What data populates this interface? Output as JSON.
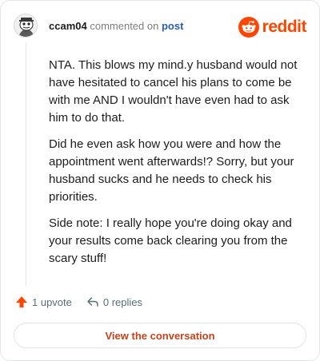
{
  "comment": {
    "username": "ccam04",
    "verb": "commented on",
    "post_link": "post",
    "paragraphs": [
      "NTA. This blows my mind.y husband would not have hesitated to cancel his plans to come be with me AND I wouldn't have even had to ask him to do that.",
      "Did he even ask how you were and how the appointment went afterwards!? Sorry, but your husband sucks and he needs to check his priorities.",
      "Side note: I really hope you're doing okay and your results come back clearing you from the scary stuff!"
    ]
  },
  "brand": {
    "wordmark": "reddit",
    "color": "#ff4500"
  },
  "actions": {
    "upvotes": "1 upvote",
    "replies": "0 replies"
  },
  "footer": {
    "view_button": "View the conversation"
  },
  "icons": {
    "avatar": "snoo-avatar-icon",
    "logo": "reddit-snoo-icon",
    "upvote": "upvote-arrow-icon",
    "reply": "reply-arrow-icon"
  }
}
